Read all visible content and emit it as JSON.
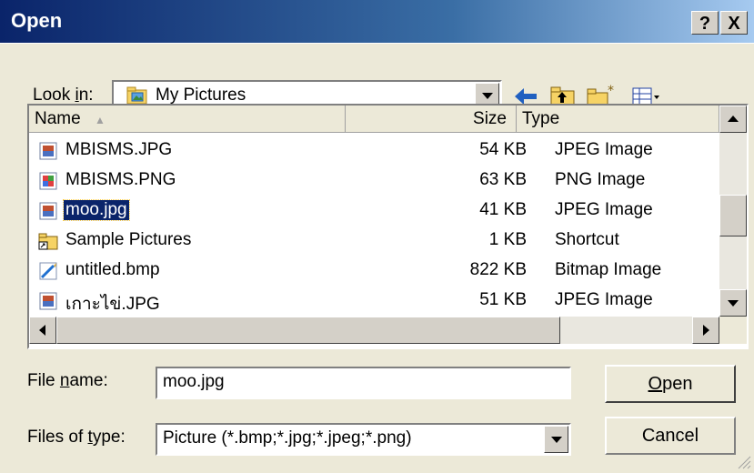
{
  "window": {
    "title": "Open",
    "help_label": "?",
    "close_label": "X"
  },
  "lookin": {
    "label_pre": "Look ",
    "label_u": "i",
    "label_post": "n:",
    "value": "My Pictures"
  },
  "columns": {
    "name": "Name",
    "size": "Size",
    "type": "Type"
  },
  "files": [
    {
      "name": "MBISMS.JPG",
      "size": "54 KB",
      "type": "JPEG Image",
      "icon": "jpeg-file-icon"
    },
    {
      "name": "MBISMS.PNG",
      "size": "63 KB",
      "type": "PNG Image",
      "icon": "png-file-icon"
    },
    {
      "name": "moo.jpg",
      "size": "41 KB",
      "type": "JPEG Image",
      "icon": "jpeg-file-icon",
      "selected": true
    },
    {
      "name": "Sample Pictures",
      "size": "1 KB",
      "type": "Shortcut",
      "icon": "folder-shortcut-icon"
    },
    {
      "name": "untitled.bmp",
      "size": "822 KB",
      "type": "Bitmap Image",
      "icon": "bitmap-file-icon"
    },
    {
      "name": "เกาะไข่.JPG",
      "size": "51 KB",
      "type": "JPEG Image",
      "icon": "jpeg-file-icon"
    }
  ],
  "filename": {
    "label_pre": "File ",
    "label_u": "n",
    "label_post": "ame:",
    "value": "moo.jpg"
  },
  "filetype": {
    "label_pre": "Files of ",
    "label_u": "t",
    "label_post": "ype:",
    "value": "Picture (*.bmp;*.jpg;*.jpeg;*.png)"
  },
  "buttons": {
    "open_u": "O",
    "open_rest": "pen",
    "cancel": "Cancel"
  }
}
